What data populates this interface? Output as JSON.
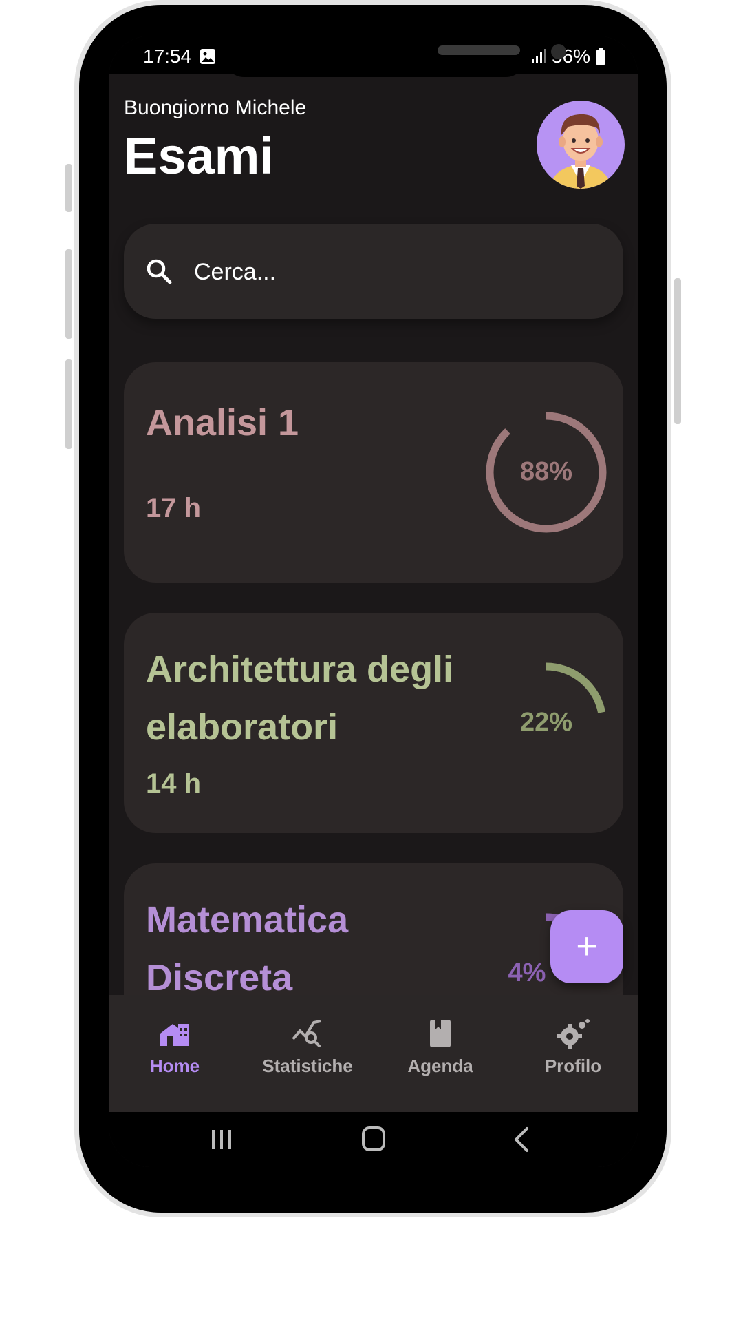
{
  "status": {
    "time": "17:54",
    "battery": "56%",
    "left_icon": "image-icon",
    "right_icons": [
      "signal-icon",
      "battery-icon"
    ]
  },
  "header": {
    "greeting": "Buongiorno Michele",
    "title": "Esami"
  },
  "search": {
    "placeholder": "Cerca..."
  },
  "exams": [
    {
      "name": "Analisi 1",
      "hours": "17 h",
      "percent": "88%",
      "progress": 0.88,
      "color": "#c4979b",
      "ring_color": "#9d787a"
    },
    {
      "name": "Architettura degli elaboratori",
      "hours": "14 h",
      "percent": "22%",
      "progress": 0.22,
      "color": "#b5c394",
      "ring_color": "#8f9d6e"
    },
    {
      "name": "Matematica Discreta",
      "hours": "",
      "percent": "4%",
      "progress": 0.04,
      "color": "#b58fd6",
      "ring_color": "#8c62b3"
    }
  ],
  "fab": {
    "label": "+"
  },
  "nav": {
    "items": [
      {
        "label": "Home",
        "icon": "home-icon",
        "active": true
      },
      {
        "label": "Statistiche",
        "icon": "stats-icon",
        "active": false
      },
      {
        "label": "Agenda",
        "icon": "book-icon",
        "active": false
      },
      {
        "label": "Profilo",
        "icon": "settings-icon",
        "active": false
      }
    ]
  },
  "colors": {
    "background": "#1b1819",
    "card": "#2c2727",
    "accent": "#b58cf3"
  }
}
